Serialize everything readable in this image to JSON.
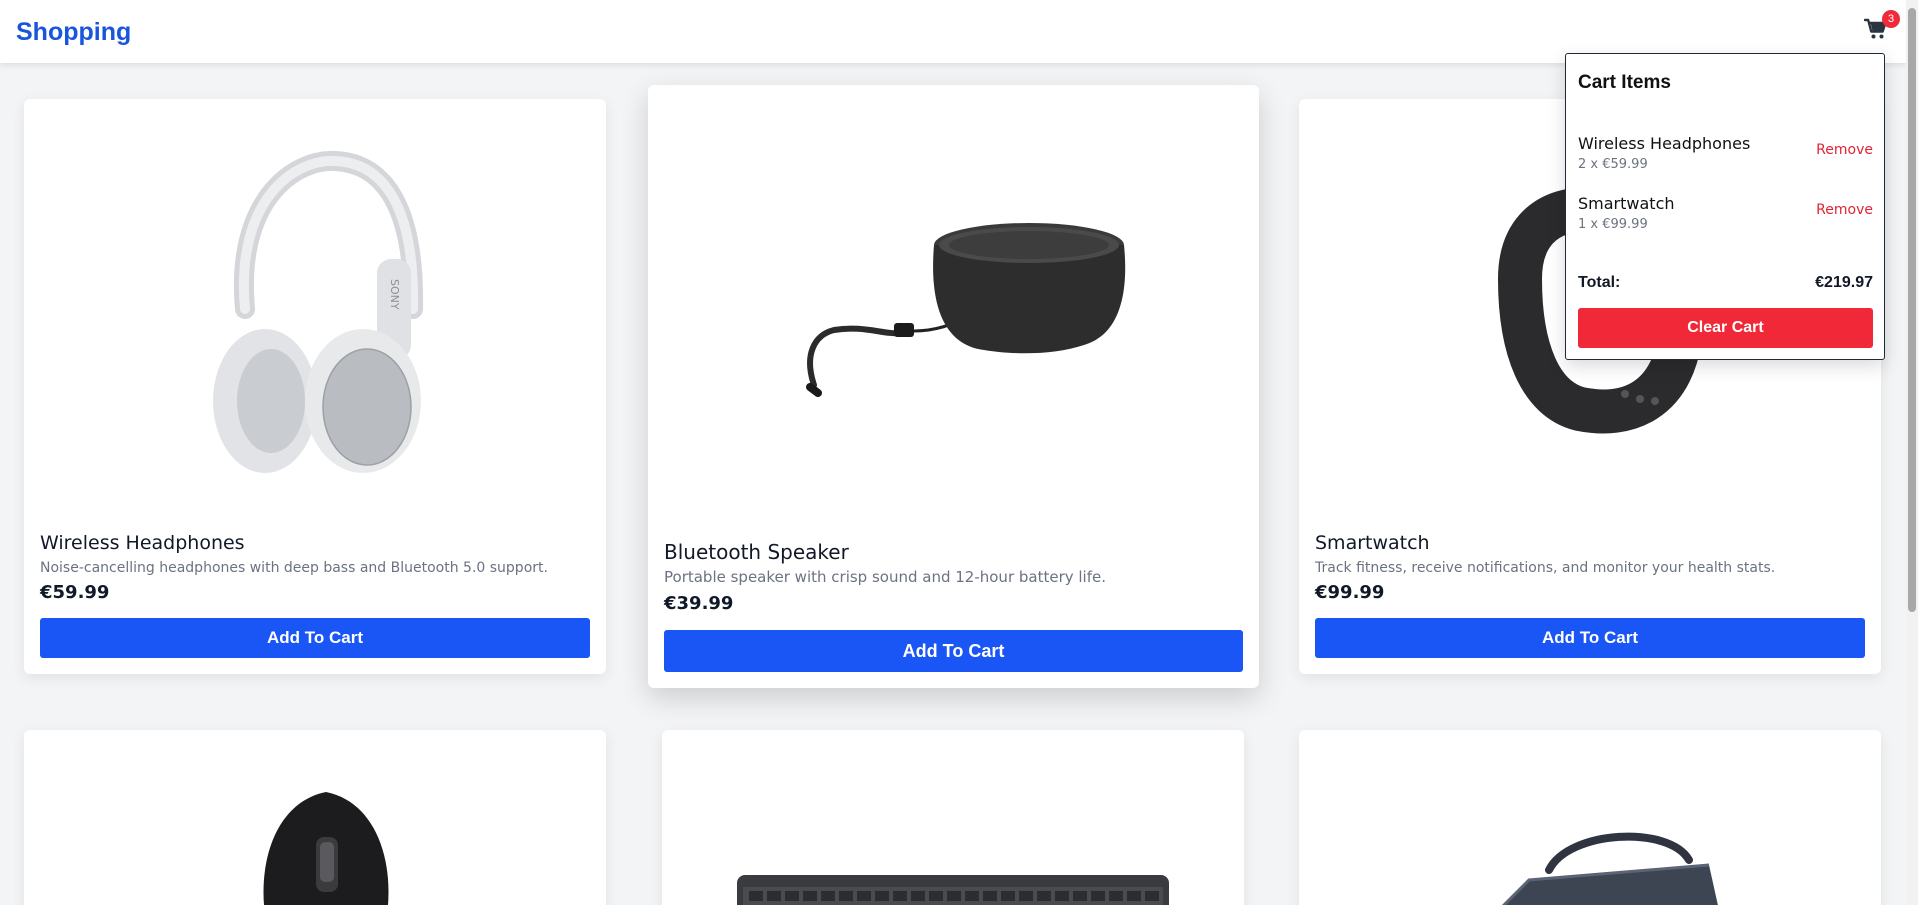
{
  "header": {
    "brand": "Shopping",
    "cart_count": "3"
  },
  "products": [
    {
      "title": "Wireless Headphones",
      "description": "Noise-cancelling headphones with deep bass and Bluetooth 5.0 support.",
      "price": "€59.99",
      "button": "Add To Cart",
      "image_brand": "SONY"
    },
    {
      "title": "Bluetooth Speaker",
      "description": "Portable speaker with crisp sound and 12-hour battery life.",
      "price": "€39.99",
      "button": "Add To Cart"
    },
    {
      "title": "Smartwatch",
      "description": "Track fitness, receive notifications, and monitor your health stats.",
      "price": "€99.99",
      "button": "Add To Cart"
    }
  ],
  "cart": {
    "title": "Cart Items",
    "items": [
      {
        "name": "Wireless Headphones",
        "qty": "2 x €59.99",
        "remove": "Remove"
      },
      {
        "name": "Smartwatch",
        "qty": "1 x €99.99",
        "remove": "Remove"
      }
    ],
    "total_label": "Total:",
    "total_value": "€219.97",
    "clear_label": "Clear Cart"
  },
  "colors": {
    "brand": "#1a56db",
    "primary_button": "#1a56f5",
    "danger": "#f02838",
    "background": "#f3f4f6"
  }
}
